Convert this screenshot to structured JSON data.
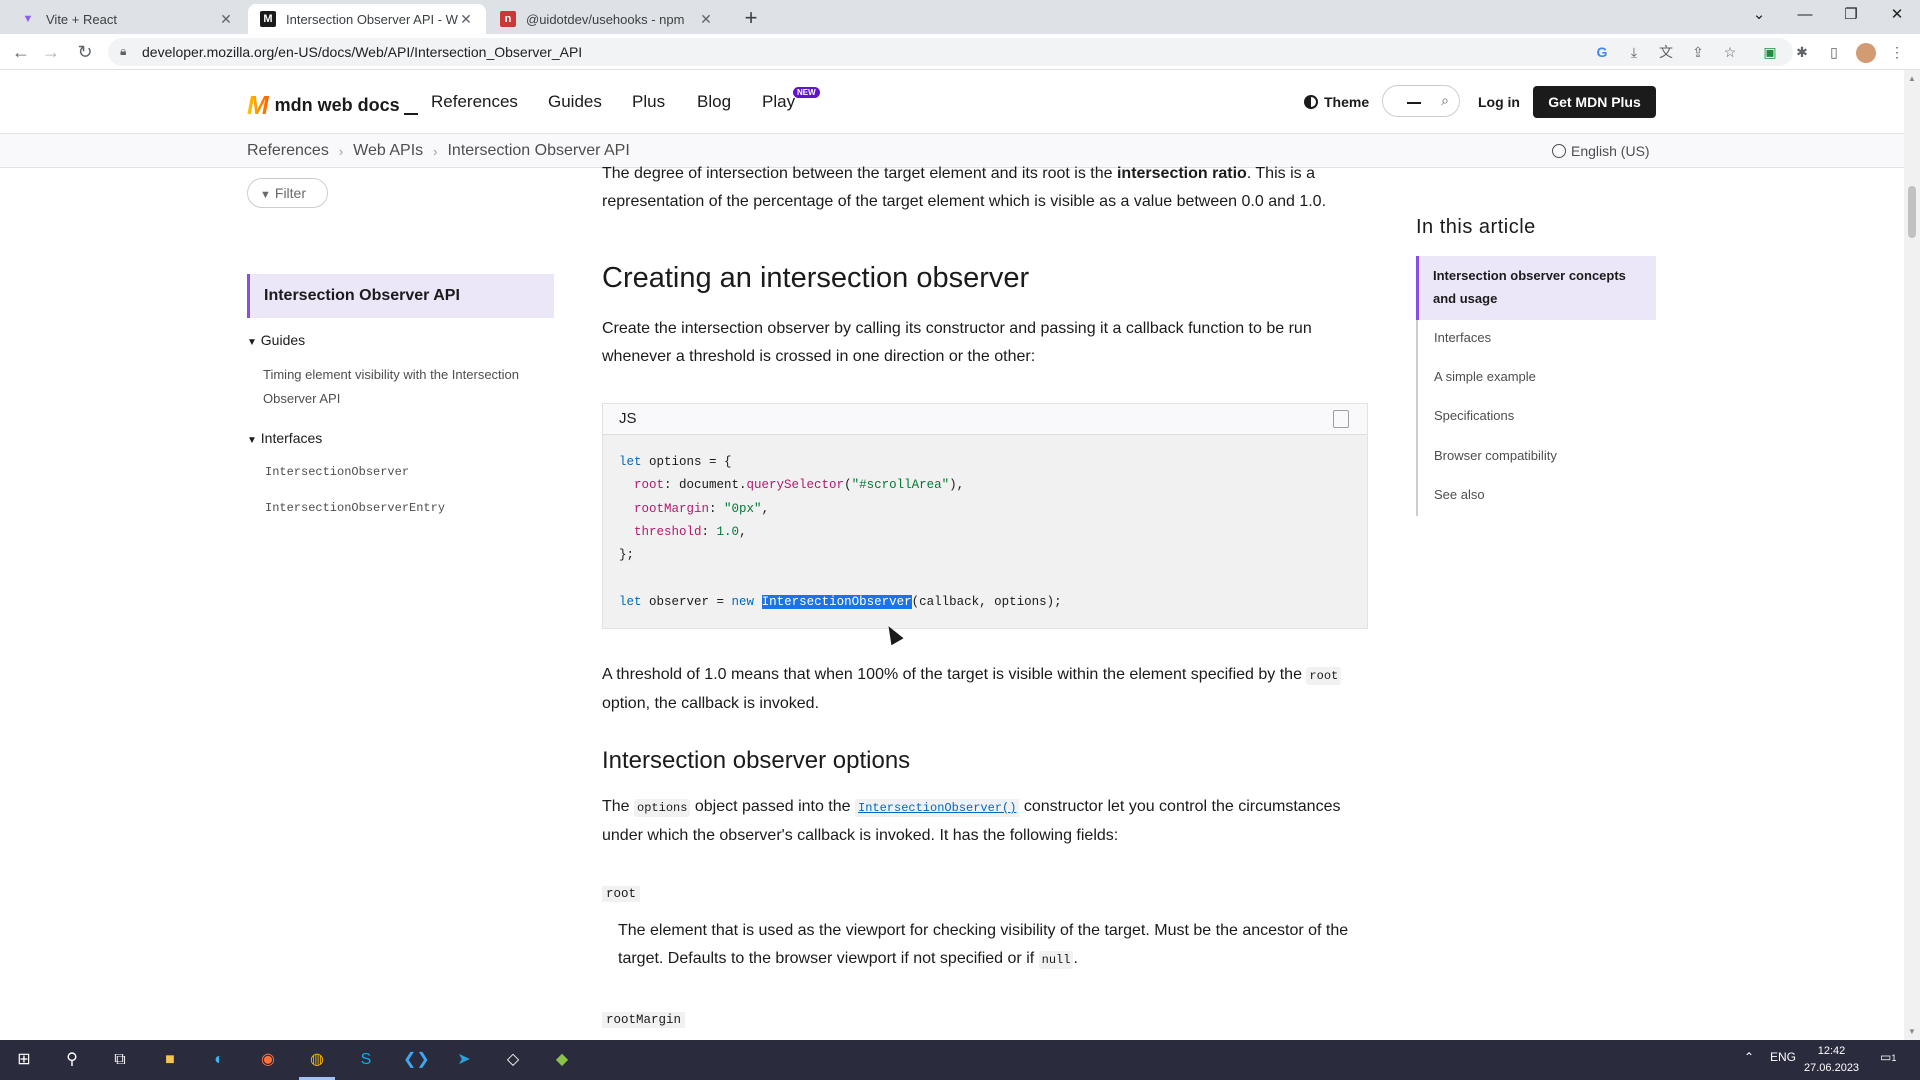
{
  "browser": {
    "tabs": [
      {
        "title": "Vite + React",
        "favicon": "vite-icon",
        "active": false
      },
      {
        "title": "Intersection Observer API - Web",
        "favicon": "mdn-icon",
        "active": true
      },
      {
        "title": "@uidotdev/usehooks - npm",
        "favicon": "npm-icon",
        "active": false
      }
    ],
    "url": "developer.mozilla.org/en-US/docs/Web/API/Intersection_Observer_API"
  },
  "header": {
    "logo": "mdn web docs",
    "nav": [
      "References",
      "Guides",
      "Plus",
      "Blog",
      "Play"
    ],
    "new_badge": "NEW",
    "theme": "Theme",
    "login": "Log in",
    "get_plus": "Get MDN Plus"
  },
  "breadcrumb": [
    "References",
    "Web APIs",
    "Intersection Observer API"
  ],
  "language": "English (US)",
  "sidebar": {
    "filter": "Filter",
    "active": "Intersection Observer API",
    "guides_label": "Guides",
    "guide_link": "Timing element visibility with the Intersection Observer API",
    "interfaces_label": "Interfaces",
    "interfaces": [
      "IntersectionObserver",
      "IntersectionObserverEntry"
    ]
  },
  "content": {
    "clipped_intro_1": "The degree of intersection between the target element and its root is the ",
    "clipped_intro_bold": "intersection ratio",
    "clipped_intro_2": ". This is a representation of the percentage of the target element which is visible as a value between 0.0 and 1.0.",
    "h2": "Creating an intersection observer",
    "p1": "Create the intersection observer by calling its constructor and passing it a callback function to be run whenever a threshold is crossed in one direction or the other:",
    "code_lang": "JS",
    "code": {
      "l1_kw": "let",
      "l1_rest": " options = {",
      "l2_prop": "root",
      "l2_mid": ": document.",
      "l2_fn": "querySelector",
      "l2_str": "\"#scrollArea\"",
      "l3_prop": "rootMargin",
      "l3_str": "\"0px\"",
      "l4_prop": "threshold",
      "l4_num": "1.0",
      "l5": "};",
      "l7_kw": "let",
      "l7_mid": " observer = ",
      "l7_new": "new",
      "l7_sel": "IntersectionObserver",
      "l7_rest": "(callback, options);"
    },
    "p2a": "A threshold of 1.0 means that when 100% of the target is visible within the element specified by the ",
    "p2_code": "root",
    "p2b": " option, the callback is invoked.",
    "h3": "Intersection observer options",
    "p3a": "The ",
    "p3_code": "options",
    "p3b": " object passed into the ",
    "p3_link": "IntersectionObserver()",
    "p3c": " constructor let you control the circumstances under which the observer's callback is invoked. It has the following fields:",
    "dt1": "root",
    "dd1a": "The element that is used as the viewport for checking visibility of the target. Must be the ancestor of the target. Defaults to the browser viewport if not specified or if ",
    "dd1_code": "null",
    "dd1b": ".",
    "dt2": "rootMargin"
  },
  "toc": {
    "heading": "In this article",
    "items": [
      "Intersection observer concepts and usage",
      "Interfaces",
      "A simple example",
      "Specifications",
      "Browser compatibility",
      "See also"
    ]
  },
  "taskbar": {
    "lang": "ENG",
    "time": "12:42",
    "date": "27.06.2023",
    "notifications": "1"
  },
  "colors": {
    "accent": "#8a4ee8",
    "link": "#0069c2",
    "selection": "#1a73e8"
  }
}
